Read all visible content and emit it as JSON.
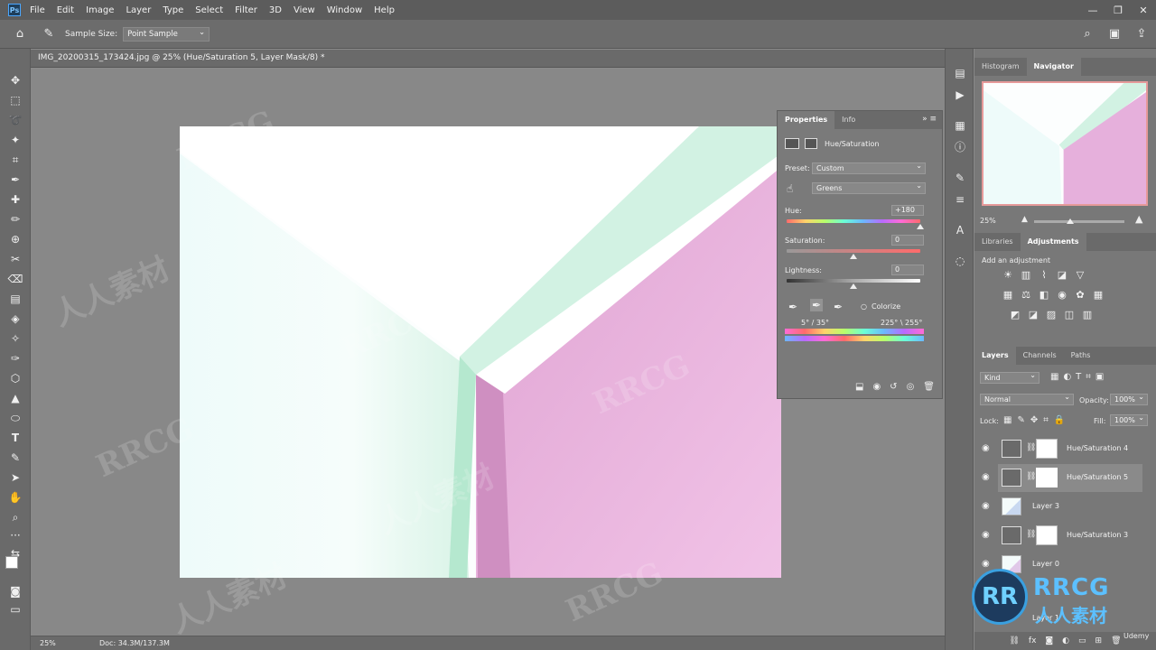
{
  "app": {
    "logo": "Ps"
  },
  "menu": [
    "File",
    "Edit",
    "Image",
    "Layer",
    "Type",
    "Select",
    "Filter",
    "3D",
    "View",
    "Window",
    "Help"
  ],
  "options": {
    "sample_size_label": "Sample Size:",
    "sample_size_value": "Point Sample"
  },
  "document": {
    "tab_title": "IMG_20200315_173424.jpg @ 25% (Hue/Saturation 5, Layer Mask/8) *"
  },
  "status": {
    "zoom": "25%",
    "doc": "Doc: 34.3M/137.3M"
  },
  "properties": {
    "tabs": [
      "Properties",
      "Info"
    ],
    "title": "Hue/Saturation",
    "preset_label": "Preset:",
    "preset_value": "Custom",
    "channel_value": "Greens",
    "hue_label": "Hue:",
    "hue_value": "+180",
    "saturation_label": "Saturation:",
    "saturation_value": "0",
    "lightness_label": "Lightness:",
    "lightness_value": "0",
    "colorize_label": "Colorize",
    "range_left": "5° / 35°",
    "range_right": "225° \\ 255°"
  },
  "panels": {
    "top_tabs": [
      "Histogram",
      "Navigator"
    ],
    "nav_zoom": "25%",
    "mid_tabs": [
      "Libraries",
      "Adjustments"
    ],
    "adjustments_hint": "Add an adjustment",
    "layers_tabs": [
      "Layers",
      "Channels",
      "Paths"
    ],
    "kind_label": "Kind",
    "blend_mode": "Normal",
    "opacity_label": "Opacity:",
    "opacity_value": "100%",
    "lock_label": "Lock:",
    "fill_label": "Fill:",
    "fill_value": "100%",
    "layers": [
      {
        "name": "Hue/Saturation 4"
      },
      {
        "name": "Hue/Saturation 5"
      },
      {
        "name": "Layer 3"
      },
      {
        "name": "Hue/Saturation 3"
      },
      {
        "name": "Layer 0"
      },
      {
        "name": "Layer 1"
      }
    ]
  },
  "watermarks": [
    "RRCG",
    "人人素材"
  ],
  "badge": {
    "mark": "RR",
    "title": "RRCG",
    "subtitle": "人人素材",
    "small": "Udemy"
  }
}
